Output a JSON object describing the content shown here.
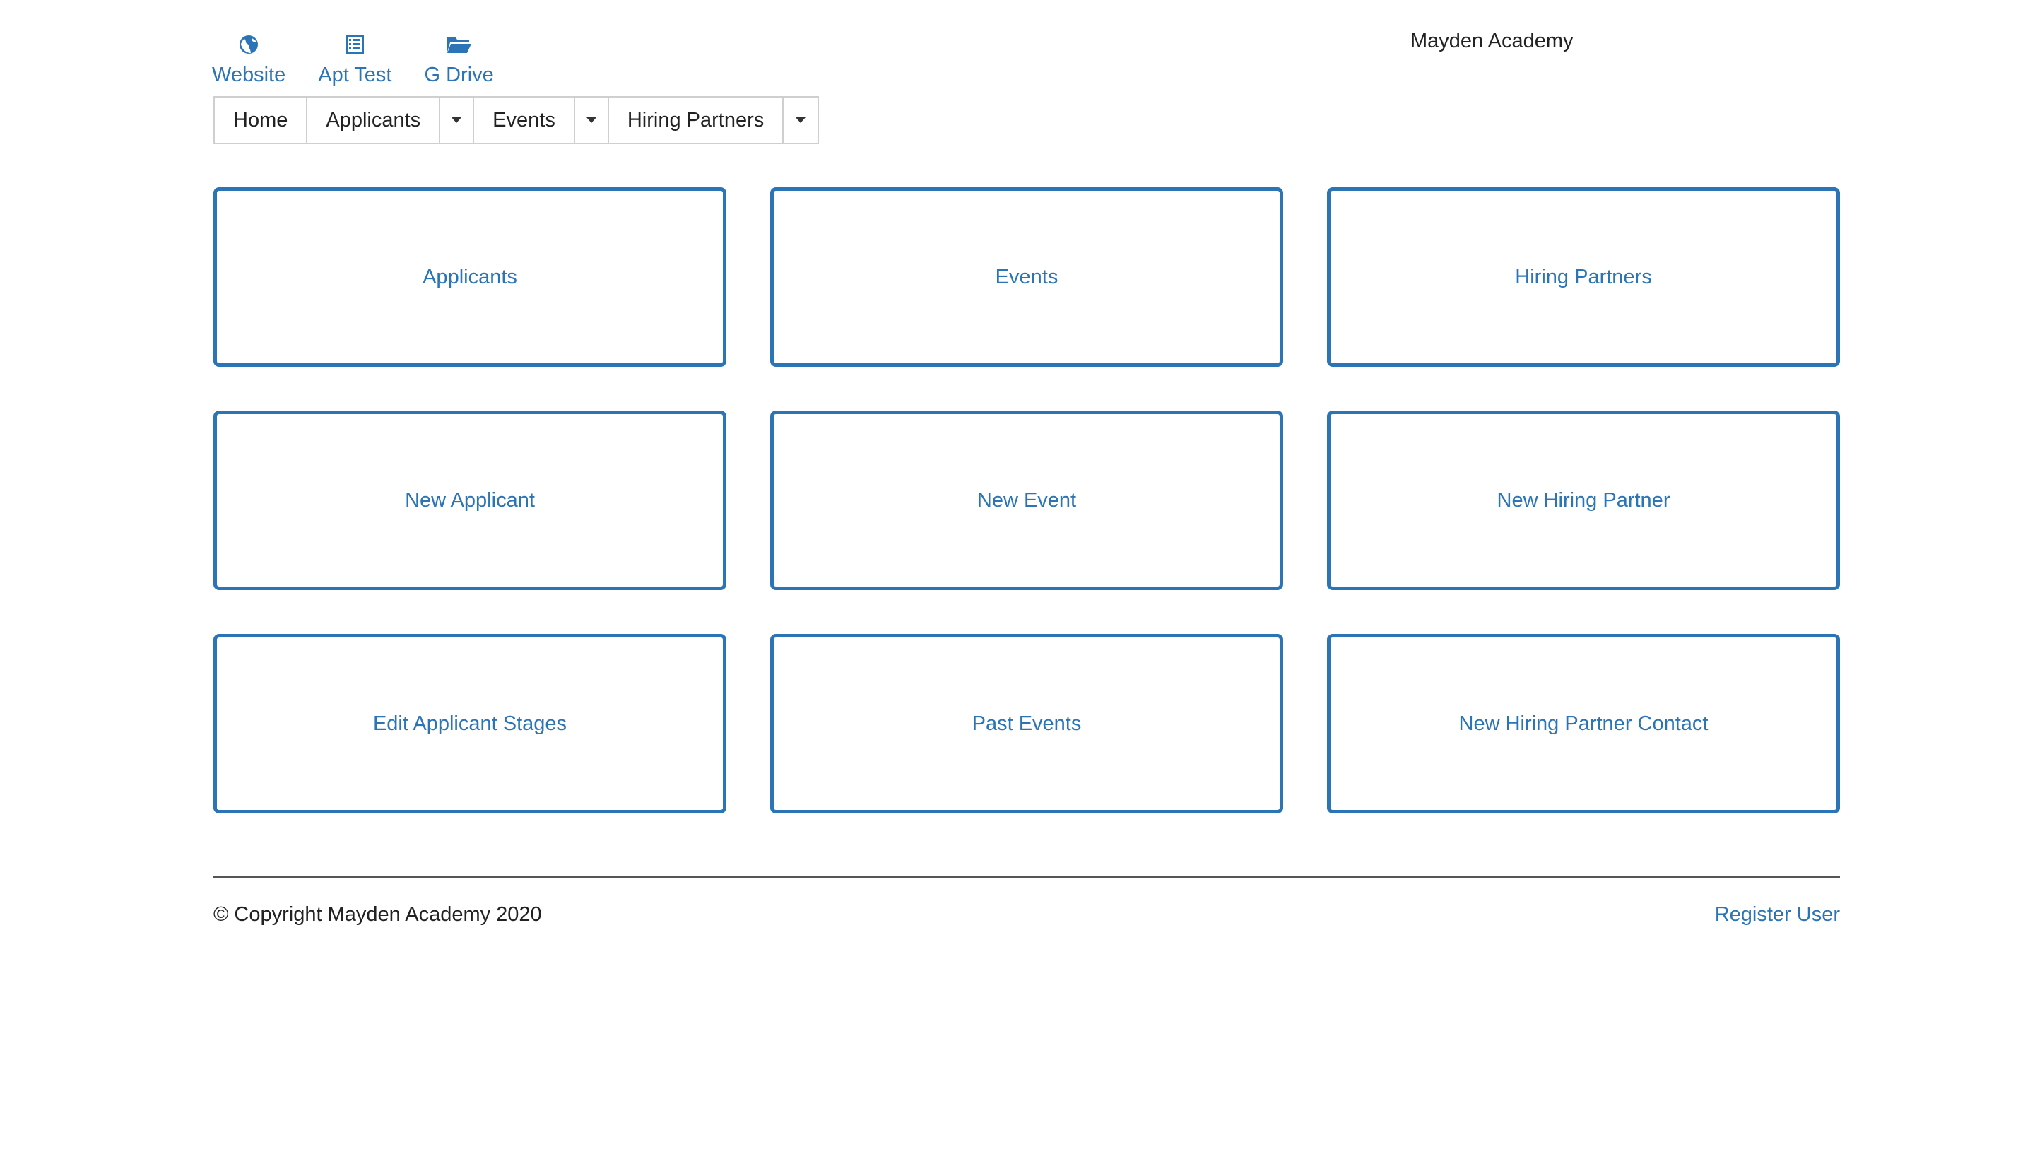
{
  "brand": "Mayden Academy",
  "quick_links": [
    {
      "label": "Website",
      "icon": "globe-icon"
    },
    {
      "label": "Apt Test",
      "icon": "list-icon"
    },
    {
      "label": "G Drive",
      "icon": "folder-open-icon"
    }
  ],
  "nav": {
    "home": "Home",
    "applicants": "Applicants",
    "events": "Events",
    "hiring_partners": "Hiring Partners"
  },
  "tiles": [
    "Applicants",
    "Events",
    "Hiring Partners",
    "New Applicant",
    "New Event",
    "New Hiring Partner",
    "Edit Applicant Stages",
    "Past Events",
    "New Hiring Partner Contact"
  ],
  "footer": {
    "copyright": "© Copyright Mayden Academy 2020",
    "register": "Register User"
  },
  "colors": {
    "accent": "#2b74b6",
    "text": "#222222",
    "border": "#cfcfcf"
  }
}
